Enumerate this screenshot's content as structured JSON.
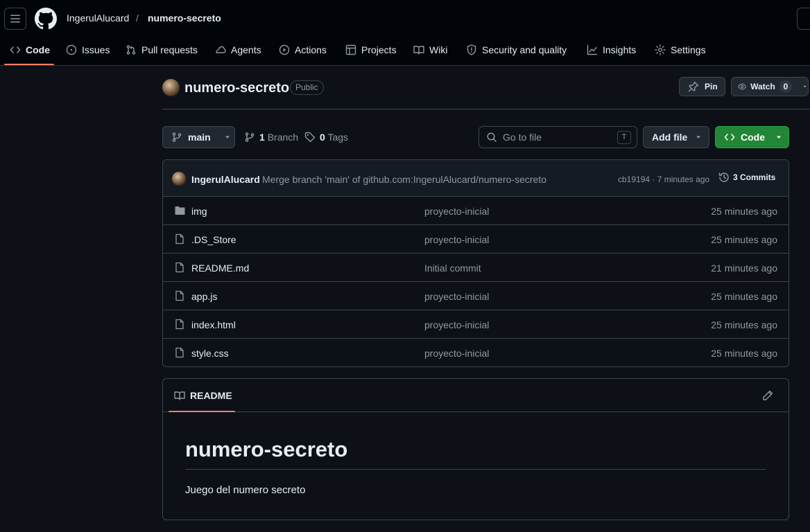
{
  "header": {
    "owner": "IngerulAlucard",
    "separator": "/",
    "repo": "numero-secreto"
  },
  "nav": {
    "tabs": [
      {
        "label": "Code",
        "icon": "code-icon",
        "selected": true
      },
      {
        "label": "Issues",
        "icon": "issue-opened-icon"
      },
      {
        "label": "Pull requests",
        "icon": "git-pull-request-icon"
      },
      {
        "label": "Agents",
        "icon": "agent-icon"
      },
      {
        "label": "Actions",
        "icon": "play-icon"
      },
      {
        "label": "Projects",
        "icon": "table-icon"
      },
      {
        "label": "Wiki",
        "icon": "book-icon"
      },
      {
        "label": "Security and quality",
        "icon": "shield-icon"
      },
      {
        "label": "Insights",
        "icon": "graph-icon"
      },
      {
        "label": "Settings",
        "icon": "gear-icon"
      }
    ]
  },
  "repo": {
    "title": "numero-secreto",
    "visibility": "Public",
    "pin_label": "Pin",
    "watch_label": "Watch",
    "watch_count": "0"
  },
  "toolbar": {
    "branch": "main",
    "branch_count": "1",
    "branch_label": "Branch",
    "tag_count": "0",
    "tag_label": "Tags",
    "goto_placeholder": "Go to file",
    "goto_kbd": "T",
    "add_file_label": "Add file",
    "code_label": "Code"
  },
  "commit": {
    "author": "IngerulAlucard",
    "message": "Merge branch 'main' of github.com:IngerulAlucard/numero-secreto",
    "meta": "cb19194 · 7 minutes ago",
    "count_label": "3 Commits"
  },
  "files": [
    {
      "name": "img",
      "type": "folder",
      "commit": "proyecto-inicial",
      "time": "25 minutes ago"
    },
    {
      "name": ".DS_Store",
      "type": "file",
      "commit": "proyecto-inicial",
      "time": "25 minutes ago"
    },
    {
      "name": "README.md",
      "type": "file",
      "commit": "Initial commit",
      "time": "21 minutes ago"
    },
    {
      "name": "app.js",
      "type": "file",
      "commit": "proyecto-inicial",
      "time": "25 minutes ago"
    },
    {
      "name": "index.html",
      "type": "file",
      "commit": "proyecto-inicial",
      "time": "25 minutes ago"
    },
    {
      "name": "style.css",
      "type": "file",
      "commit": "proyecto-inicial",
      "time": "25 minutes ago"
    }
  ],
  "readme": {
    "tab_label": "README",
    "heading": "numero-secreto",
    "body": "Juego del numero secreto"
  },
  "colors": {
    "accent_underline": "#f78166",
    "code_button": "#238636",
    "background": "#0d1117"
  }
}
